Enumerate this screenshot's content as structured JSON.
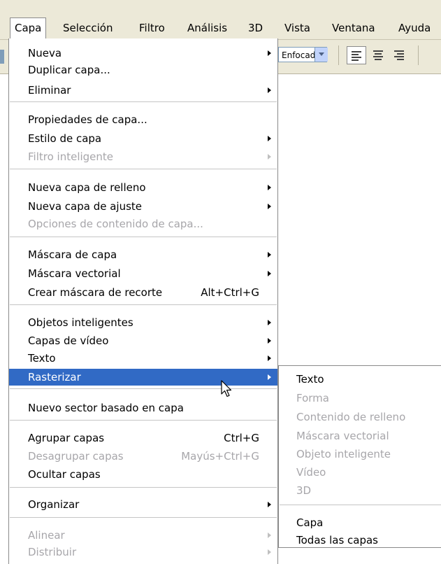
{
  "menubar": {
    "items": [
      {
        "label": "Capa"
      },
      {
        "label": "Selección"
      },
      {
        "label": "Filtro"
      },
      {
        "label": "Análisis"
      },
      {
        "label": "3D"
      },
      {
        "label": "Vista"
      },
      {
        "label": "Ventana"
      },
      {
        "label": "Ayuda"
      }
    ]
  },
  "options_bar": {
    "antialias_value": "Enfocado"
  },
  "layer_menu": {
    "items": [
      {
        "label": "Nueva",
        "submenu": true
      },
      {
        "label": "Duplicar capa..."
      },
      {
        "label": "Eliminar",
        "submenu": true
      },
      {
        "label": "Propiedades de capa..."
      },
      {
        "label": "Estilo de capa",
        "submenu": true
      },
      {
        "label": "Filtro inteligente",
        "submenu": true,
        "disabled": true
      },
      {
        "label": "Nueva capa de relleno",
        "submenu": true
      },
      {
        "label": "Nueva capa de ajuste",
        "submenu": true
      },
      {
        "label": "Opciones de contenido de capa...",
        "disabled": true
      },
      {
        "label": "Máscara de capa",
        "submenu": true
      },
      {
        "label": "Máscara vectorial",
        "submenu": true
      },
      {
        "label": "Crear máscara de recorte",
        "shortcut": "Alt+Ctrl+G"
      },
      {
        "label": "Objetos inteligentes",
        "submenu": true
      },
      {
        "label": "Capas de vídeo",
        "submenu": true
      },
      {
        "label": "Texto",
        "submenu": true
      },
      {
        "label": "Rasterizar",
        "submenu": true,
        "selected": true
      },
      {
        "label": "Nuevo sector basado en capa"
      },
      {
        "label": "Agrupar capas",
        "shortcut": "Ctrl+G"
      },
      {
        "label": "Desagrupar capas",
        "shortcut": "Mayús+Ctrl+G",
        "disabled": true
      },
      {
        "label": "Ocultar capas"
      },
      {
        "label": "Organizar",
        "submenu": true
      },
      {
        "label": "Alinear",
        "submenu": true,
        "disabled": true
      },
      {
        "label": "Distribuir",
        "submenu": true,
        "disabled": true
      }
    ]
  },
  "rasterize_submenu": {
    "items": [
      {
        "label": "Texto"
      },
      {
        "label": "Forma",
        "disabled": true
      },
      {
        "label": "Contenido de relleno",
        "disabled": true
      },
      {
        "label": "Máscara vectorial",
        "disabled": true
      },
      {
        "label": "Objeto inteligente",
        "disabled": true
      },
      {
        "label": "Vídeo",
        "disabled": true
      },
      {
        "label": "3D",
        "disabled": true
      },
      {
        "label": "Capa"
      },
      {
        "label": "Todas las capas"
      }
    ]
  },
  "colors": {
    "highlight": "#316ac5",
    "disabled_text": "#a7a6aa",
    "menubar_bg": "#ece9d8"
  }
}
